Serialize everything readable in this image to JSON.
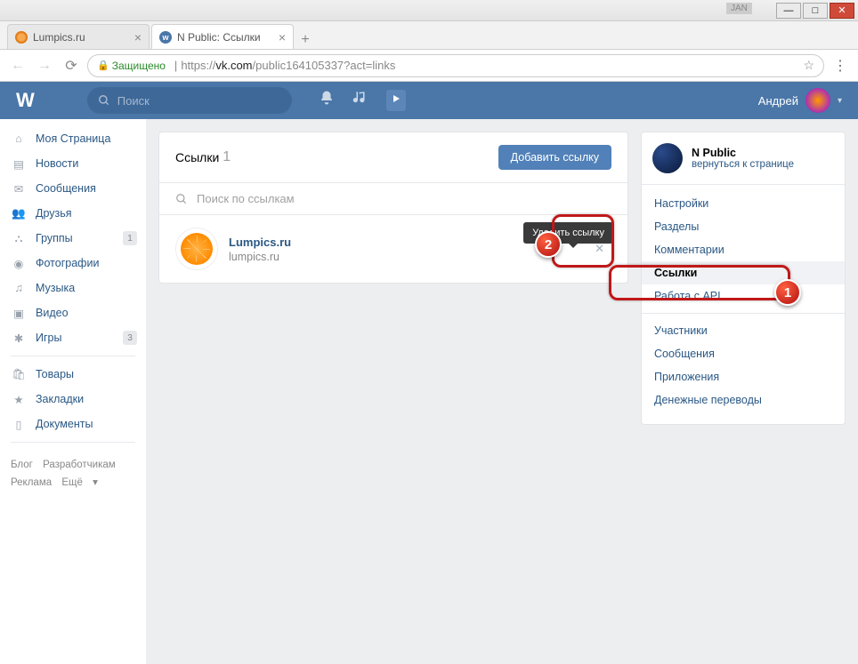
{
  "window": {
    "jan": "JAN"
  },
  "tabs": [
    {
      "title": "Lumpics.ru"
    },
    {
      "title": "N Public: Ссылки"
    }
  ],
  "address": {
    "secure": "Защищено",
    "proto": "https://",
    "domain": "vk.com",
    "path": "/public164105337?act=links"
  },
  "vk_header": {
    "search_placeholder": "Поиск",
    "user_name": "Андрей"
  },
  "sidebar": {
    "items": [
      {
        "label": "Моя Страница"
      },
      {
        "label": "Новости"
      },
      {
        "label": "Сообщения"
      },
      {
        "label": "Друзья"
      },
      {
        "label": "Группы",
        "badge": "1"
      },
      {
        "label": "Фотографии"
      },
      {
        "label": "Музыка"
      },
      {
        "label": "Видео"
      },
      {
        "label": "Игры",
        "badge": "3"
      }
    ],
    "items2": [
      {
        "label": "Товары"
      },
      {
        "label": "Закладки"
      },
      {
        "label": "Документы"
      }
    ],
    "footer": {
      "blog": "Блог",
      "dev": "Разработчикам",
      "ads": "Реклама",
      "more": "Ещё"
    }
  },
  "content": {
    "title": "Ссылки",
    "count": "1",
    "add_button": "Добавить ссылку",
    "search_placeholder": "Поиск по ссылкам",
    "link": {
      "name": "Lumpics.ru",
      "url": "lumpics.ru"
    },
    "tooltip": "Удалить ссылку"
  },
  "side_panel": {
    "title": "N Public",
    "back": "вернуться к странице",
    "menu1": [
      "Настройки",
      "Разделы",
      "Комментарии",
      "Ссылки",
      "Работа с API"
    ],
    "menu2": [
      "Участники",
      "Сообщения",
      "Приложения",
      "Денежные переводы"
    ]
  },
  "annotations": {
    "one": "1",
    "two": "2"
  }
}
